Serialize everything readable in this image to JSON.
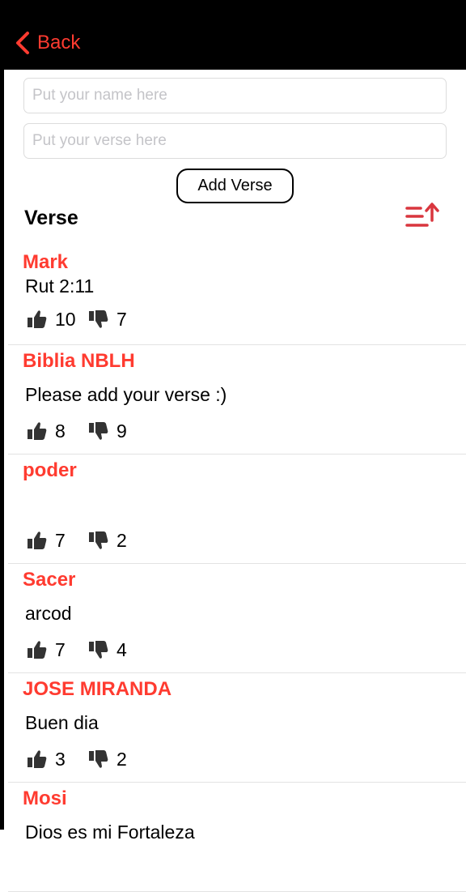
{
  "nav": {
    "back_label": "Back"
  },
  "form": {
    "name_placeholder": "Put your name here",
    "verse_placeholder": "Put your verse here",
    "add_button_label": "Add Verse"
  },
  "section": {
    "title": "Verse",
    "sort_icon": "sort-ascending-icon"
  },
  "colors": {
    "accent": "#ff3b30",
    "navbar": "#000000",
    "divider": "#e3e3e3"
  },
  "verses": [
    {
      "author": "Mark",
      "verse": "Rut 2:11",
      "likes": "10",
      "dislikes": "7"
    },
    {
      "author": "Biblia NBLH",
      "verse": "Please add your verse :)",
      "likes": "8",
      "dislikes": "9"
    },
    {
      "author": "poder",
      "verse": "",
      "likes": "7",
      "dislikes": "2"
    },
    {
      "author": "Sacer",
      "verse": "arcod",
      "likes": "7",
      "dislikes": "4"
    },
    {
      "author": "JOSE MIRANDA",
      "verse": "Buen dia",
      "likes": "3",
      "dislikes": "2"
    },
    {
      "author": "Mosi",
      "verse": "Dios es mi Fortaleza",
      "likes": "",
      "dislikes": ""
    }
  ]
}
